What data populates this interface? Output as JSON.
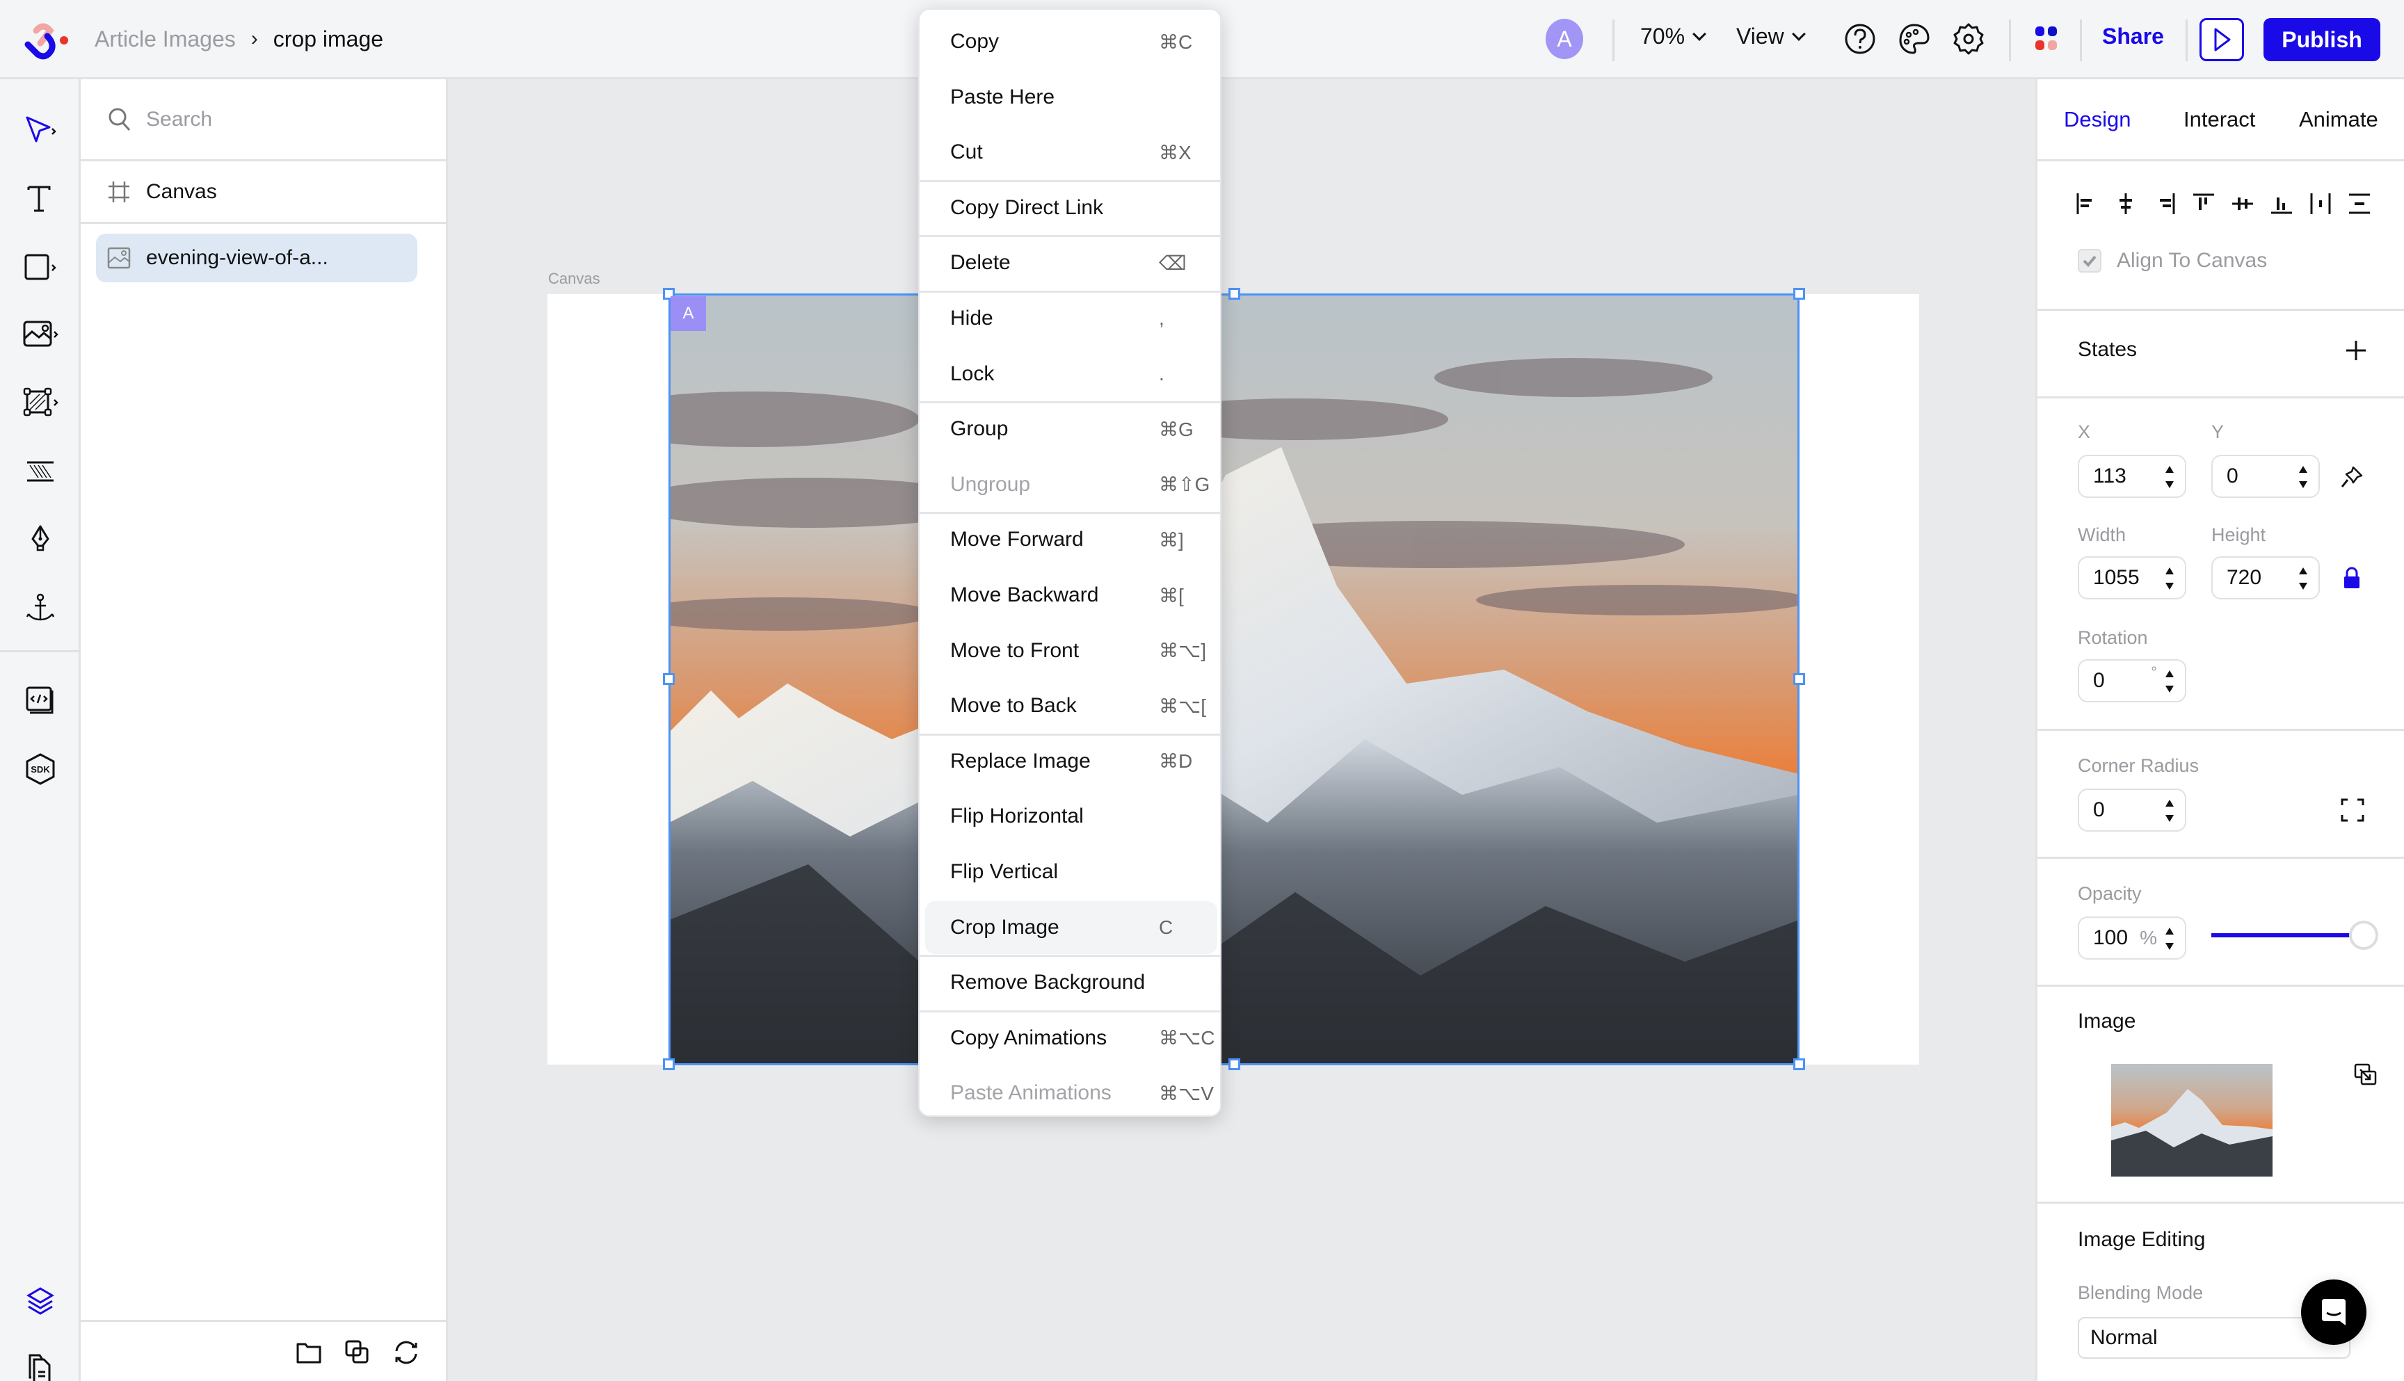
{
  "app": {
    "brand_colors": {
      "accent": "#1a0ae8",
      "logo_pink": "#f2a5a1",
      "logo_red": "#e8352c",
      "avatar": "#a195f5",
      "selection": "#4d93f5"
    }
  },
  "topbar": {
    "breadcrumb": {
      "parent": "Article Images",
      "separator": "›",
      "current": "crop image"
    },
    "avatar_initial": "A",
    "zoom": "70%",
    "view_label": "View",
    "share_label": "Share",
    "publish_label": "Publish",
    "icons": [
      "help-icon",
      "palette-icon",
      "settings-icon",
      "apps-grid-icon",
      "preview-play-icon"
    ]
  },
  "tool_rail": {
    "items": [
      {
        "name": "select-tool",
        "icon": "pointer-icon",
        "has_submenu": true,
        "active": true
      },
      {
        "name": "text-tool",
        "icon": "text-icon",
        "has_submenu": false
      },
      {
        "name": "shape-tool",
        "icon": "rectangle-icon",
        "has_submenu": true
      },
      {
        "name": "image-tool",
        "icon": "image-icon",
        "has_submenu": true
      },
      {
        "name": "frame-tool",
        "icon": "frame-icon",
        "has_submenu": true
      },
      {
        "name": "spacer-tool",
        "icon": "spacer-icon",
        "has_submenu": false
      },
      {
        "name": "pen-tool",
        "icon": "pen-icon",
        "has_submenu": false
      },
      {
        "name": "anchor-tool",
        "icon": "anchor-icon",
        "has_submenu": false
      },
      {
        "name": "embed-tool",
        "icon": "code-embed-icon",
        "has_submenu": false
      },
      {
        "name": "sdk-tool",
        "icon": "sdk-icon",
        "has_submenu": false
      }
    ],
    "bottom": [
      {
        "name": "layers-toggle",
        "icon": "layers-icon",
        "active": true
      },
      {
        "name": "pages-toggle",
        "icon": "pages-icon"
      }
    ]
  },
  "layers_panel": {
    "search_placeholder": "Search",
    "items": [
      {
        "label": "Canvas",
        "icon": "frame-grid-icon",
        "selected": false
      },
      {
        "label": "evening-view-of-a...",
        "icon": "image-icon",
        "selected": true
      }
    ],
    "footer_icons": [
      "folder-icon",
      "duplicate-icon",
      "refresh-icon"
    ]
  },
  "canvas": {
    "label": "Canvas",
    "selected_badge": "A"
  },
  "context_menu": {
    "groups": [
      [
        {
          "label": "Copy",
          "shortcut": "⌘C"
        },
        {
          "label": "Paste Here",
          "shortcut": ""
        },
        {
          "label": "Cut",
          "shortcut": "⌘X"
        }
      ],
      [
        {
          "label": "Copy Direct Link",
          "shortcut": ""
        }
      ],
      [
        {
          "label": "Delete",
          "shortcut": "⌫"
        }
      ],
      [
        {
          "label": "Hide",
          "shortcut": ","
        },
        {
          "label": "Lock",
          "shortcut": "."
        }
      ],
      [
        {
          "label": "Group",
          "shortcut": "⌘G"
        },
        {
          "label": "Ungroup",
          "shortcut": "⌘⇧G",
          "disabled": true
        }
      ],
      [
        {
          "label": "Move Forward",
          "shortcut": "⌘]"
        },
        {
          "label": "Move Backward",
          "shortcut": "⌘["
        },
        {
          "label": "Move to Front",
          "shortcut": "⌘⌥]"
        },
        {
          "label": "Move to Back",
          "shortcut": "⌘⌥["
        }
      ],
      [
        {
          "label": "Replace Image",
          "shortcut": "⌘D"
        },
        {
          "label": "Flip Horizontal",
          "shortcut": ""
        },
        {
          "label": "Flip Vertical",
          "shortcut": ""
        },
        {
          "label": "Crop Image",
          "shortcut": "C",
          "highlighted": true
        }
      ],
      [
        {
          "label": "Remove Background",
          "shortcut": ""
        }
      ],
      [
        {
          "label": "Copy Animations",
          "shortcut": "⌘⌥C"
        },
        {
          "label": "Paste Animations",
          "shortcut": "⌘⌥V",
          "disabled": true
        }
      ]
    ]
  },
  "properties": {
    "tabs": [
      {
        "label": "Design",
        "active": true
      },
      {
        "label": "Interact",
        "active": false
      },
      {
        "label": "Animate",
        "active": false
      }
    ],
    "align_icons": [
      "align-left-icon",
      "align-center-h-icon",
      "align-right-icon",
      "align-top-icon",
      "align-center-v-icon",
      "align-bottom-icon",
      "distribute-h-icon",
      "distribute-v-icon"
    ],
    "align_to_canvas": {
      "label": "Align To Canvas",
      "checked": true
    },
    "states_label": "States",
    "x": {
      "label": "X",
      "value": "113"
    },
    "y": {
      "label": "Y",
      "value": "0"
    },
    "width": {
      "label": "Width",
      "value": "1055"
    },
    "height": {
      "label": "Height",
      "value": "720"
    },
    "aspect_locked": true,
    "rotation": {
      "label": "Rotation",
      "value": "0",
      "unit": "°"
    },
    "corner_radius": {
      "label": "Corner Radius",
      "value": "0"
    },
    "opacity": {
      "label": "Opacity",
      "value": "100",
      "unit": "%",
      "fraction": 1.0
    },
    "image_section": "Image",
    "image_editing_section": "Image Editing",
    "blending_mode": {
      "label": "Blending Mode",
      "value": "Normal"
    }
  }
}
